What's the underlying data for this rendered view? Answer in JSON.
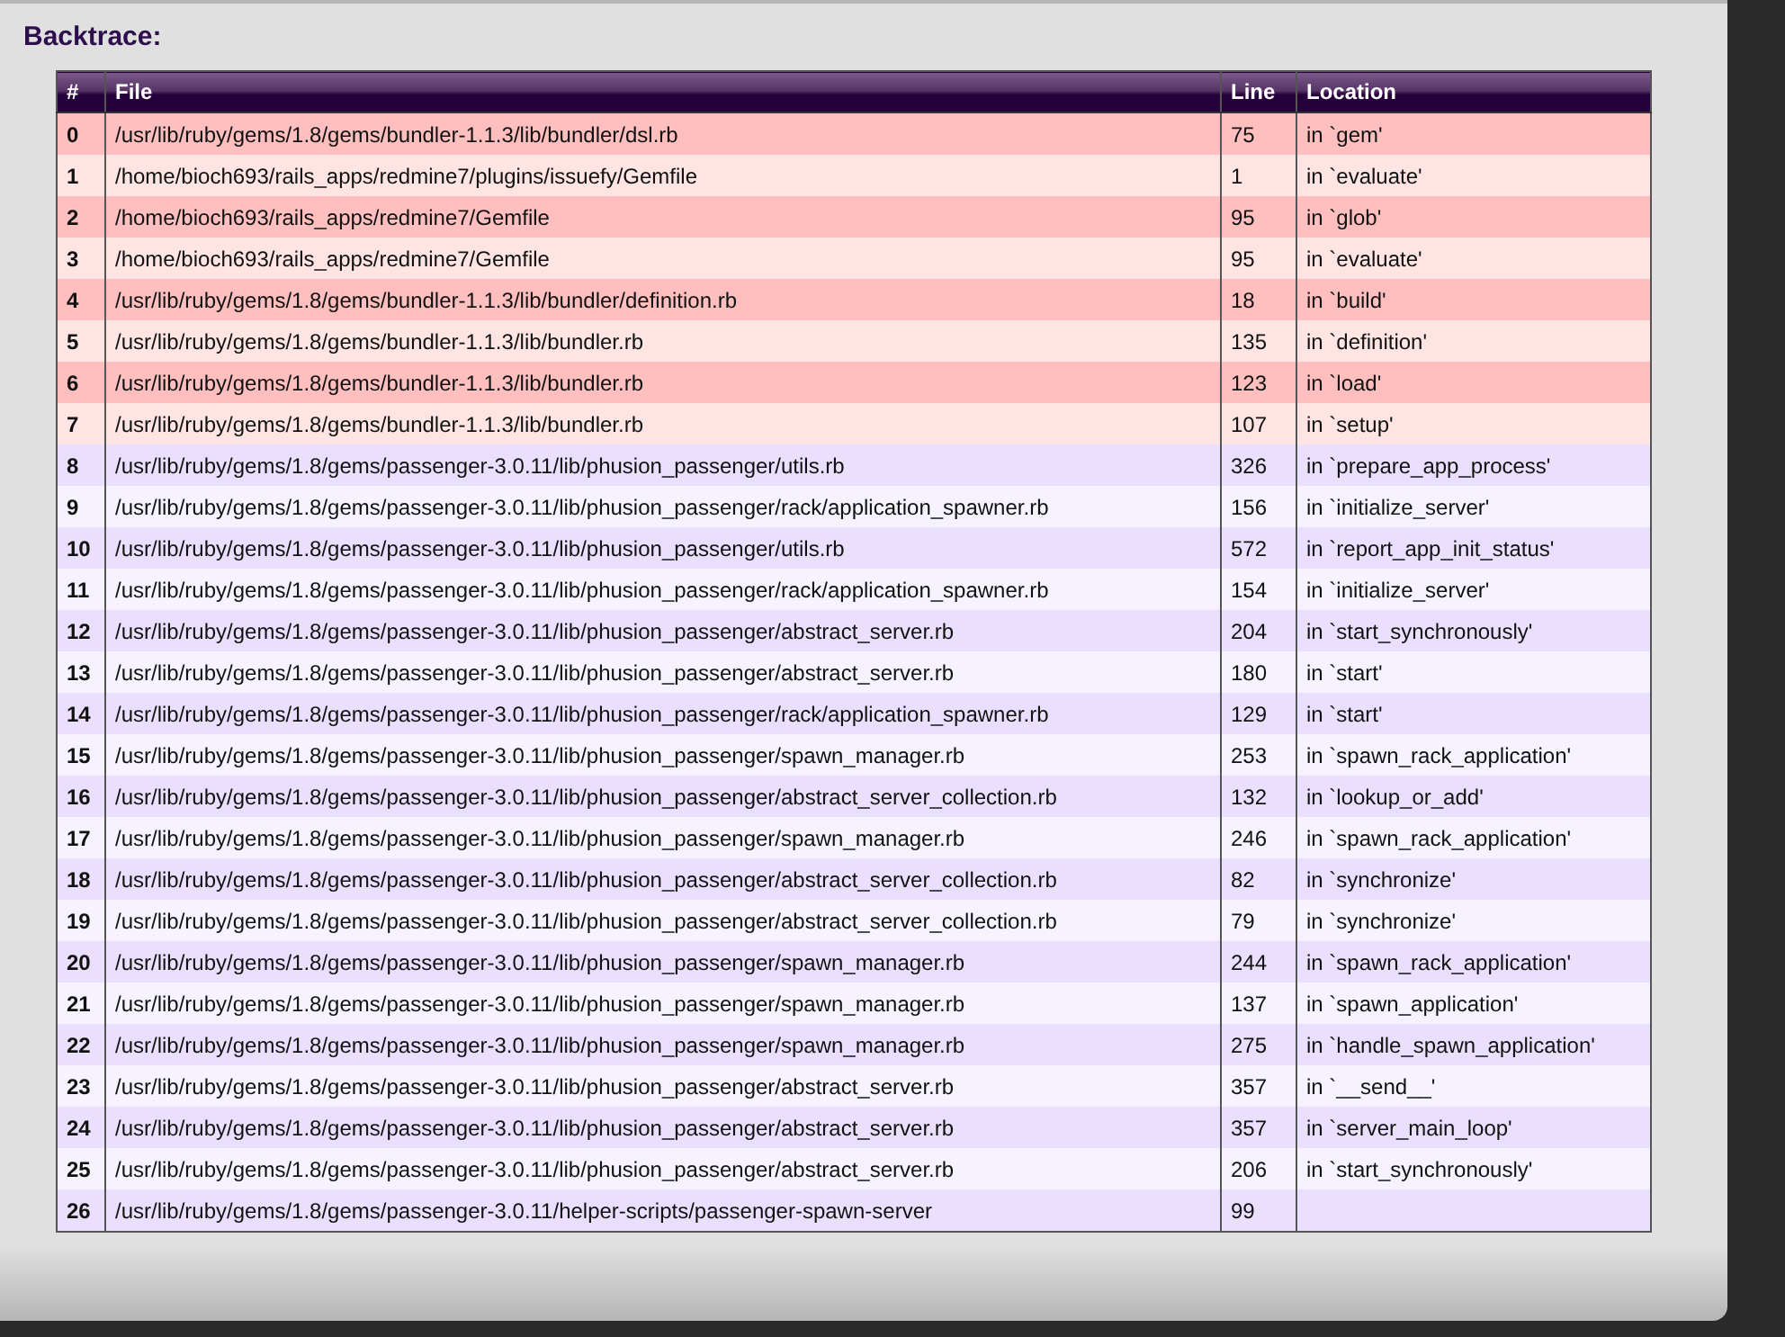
{
  "title": "Backtrace:",
  "table": {
    "columns": [
      "#",
      "File",
      "Line",
      "Location"
    ],
    "rows": [
      {
        "kind": "app",
        "index": "0",
        "file": "/usr/lib/ruby/gems/1.8/gems/bundler-1.1.3/lib/bundler/dsl.rb",
        "line": "75",
        "location": "in `gem'"
      },
      {
        "kind": "app",
        "index": "1",
        "file": "/home/bioch693/rails_apps/redmine7/plugins/issuefy/Gemfile",
        "line": "1",
        "location": "in `evaluate'"
      },
      {
        "kind": "app",
        "index": "2",
        "file": "/home/bioch693/rails_apps/redmine7/Gemfile",
        "line": "95",
        "location": "in `glob'"
      },
      {
        "kind": "app",
        "index": "3",
        "file": "/home/bioch693/rails_apps/redmine7/Gemfile",
        "line": "95",
        "location": "in `evaluate'"
      },
      {
        "kind": "app",
        "index": "4",
        "file": "/usr/lib/ruby/gems/1.8/gems/bundler-1.1.3/lib/bundler/definition.rb",
        "line": "18",
        "location": "in `build'"
      },
      {
        "kind": "app",
        "index": "5",
        "file": "/usr/lib/ruby/gems/1.8/gems/bundler-1.1.3/lib/bundler.rb",
        "line": "135",
        "location": "in `definition'"
      },
      {
        "kind": "app",
        "index": "6",
        "file": "/usr/lib/ruby/gems/1.8/gems/bundler-1.1.3/lib/bundler.rb",
        "line": "123",
        "location": "in `load'"
      },
      {
        "kind": "app",
        "index": "7",
        "file": "/usr/lib/ruby/gems/1.8/gems/bundler-1.1.3/lib/bundler.rb",
        "line": "107",
        "location": "in `setup'"
      },
      {
        "kind": "framework",
        "index": "8",
        "file": "/usr/lib/ruby/gems/1.8/gems/passenger-3.0.11/lib/phusion_passenger/utils.rb",
        "line": "326",
        "location": "in `prepare_app_process'"
      },
      {
        "kind": "framework",
        "index": "9",
        "file": "/usr/lib/ruby/gems/1.8/gems/passenger-3.0.11/lib/phusion_passenger/rack/application_spawner.rb",
        "line": "156",
        "location": "in `initialize_server'"
      },
      {
        "kind": "framework",
        "index": "10",
        "file": "/usr/lib/ruby/gems/1.8/gems/passenger-3.0.11/lib/phusion_passenger/utils.rb",
        "line": "572",
        "location": "in `report_app_init_status'"
      },
      {
        "kind": "framework",
        "index": "11",
        "file": "/usr/lib/ruby/gems/1.8/gems/passenger-3.0.11/lib/phusion_passenger/rack/application_spawner.rb",
        "line": "154",
        "location": "in `initialize_server'"
      },
      {
        "kind": "framework",
        "index": "12",
        "file": "/usr/lib/ruby/gems/1.8/gems/passenger-3.0.11/lib/phusion_passenger/abstract_server.rb",
        "line": "204",
        "location": "in `start_synchronously'"
      },
      {
        "kind": "framework",
        "index": "13",
        "file": "/usr/lib/ruby/gems/1.8/gems/passenger-3.0.11/lib/phusion_passenger/abstract_server.rb",
        "line": "180",
        "location": "in `start'"
      },
      {
        "kind": "framework",
        "index": "14",
        "file": "/usr/lib/ruby/gems/1.8/gems/passenger-3.0.11/lib/phusion_passenger/rack/application_spawner.rb",
        "line": "129",
        "location": "in `start'"
      },
      {
        "kind": "framework",
        "index": "15",
        "file": "/usr/lib/ruby/gems/1.8/gems/passenger-3.0.11/lib/phusion_passenger/spawn_manager.rb",
        "line": "253",
        "location": "in `spawn_rack_application'"
      },
      {
        "kind": "framework",
        "index": "16",
        "file": "/usr/lib/ruby/gems/1.8/gems/passenger-3.0.11/lib/phusion_passenger/abstract_server_collection.rb",
        "line": "132",
        "location": "in `lookup_or_add'"
      },
      {
        "kind": "framework",
        "index": "17",
        "file": "/usr/lib/ruby/gems/1.8/gems/passenger-3.0.11/lib/phusion_passenger/spawn_manager.rb",
        "line": "246",
        "location": "in `spawn_rack_application'"
      },
      {
        "kind": "framework",
        "index": "18",
        "file": "/usr/lib/ruby/gems/1.8/gems/passenger-3.0.11/lib/phusion_passenger/abstract_server_collection.rb",
        "line": "82",
        "location": "in `synchronize'"
      },
      {
        "kind": "framework",
        "index": "19",
        "file": "/usr/lib/ruby/gems/1.8/gems/passenger-3.0.11/lib/phusion_passenger/abstract_server_collection.rb",
        "line": "79",
        "location": "in `synchronize'"
      },
      {
        "kind": "framework",
        "index": "20",
        "file": "/usr/lib/ruby/gems/1.8/gems/passenger-3.0.11/lib/phusion_passenger/spawn_manager.rb",
        "line": "244",
        "location": "in `spawn_rack_application'"
      },
      {
        "kind": "framework",
        "index": "21",
        "file": "/usr/lib/ruby/gems/1.8/gems/passenger-3.0.11/lib/phusion_passenger/spawn_manager.rb",
        "line": "137",
        "location": "in `spawn_application'"
      },
      {
        "kind": "framework",
        "index": "22",
        "file": "/usr/lib/ruby/gems/1.8/gems/passenger-3.0.11/lib/phusion_passenger/spawn_manager.rb",
        "line": "275",
        "location": "in `handle_spawn_application'"
      },
      {
        "kind": "framework",
        "index": "23",
        "file": "/usr/lib/ruby/gems/1.8/gems/passenger-3.0.11/lib/phusion_passenger/abstract_server.rb",
        "line": "357",
        "location": "in `__send__'"
      },
      {
        "kind": "framework",
        "index": "24",
        "file": "/usr/lib/ruby/gems/1.8/gems/passenger-3.0.11/lib/phusion_passenger/abstract_server.rb",
        "line": "357",
        "location": "in `server_main_loop'"
      },
      {
        "kind": "framework",
        "index": "25",
        "file": "/usr/lib/ruby/gems/1.8/gems/passenger-3.0.11/lib/phusion_passenger/abstract_server.rb",
        "line": "206",
        "location": "in `start_synchronously'"
      },
      {
        "kind": "framework",
        "index": "26",
        "file": "/usr/lib/ruby/gems/1.8/gems/passenger-3.0.11/helper-scripts/passenger-spawn-server",
        "line": "99"
      }
    ]
  }
}
